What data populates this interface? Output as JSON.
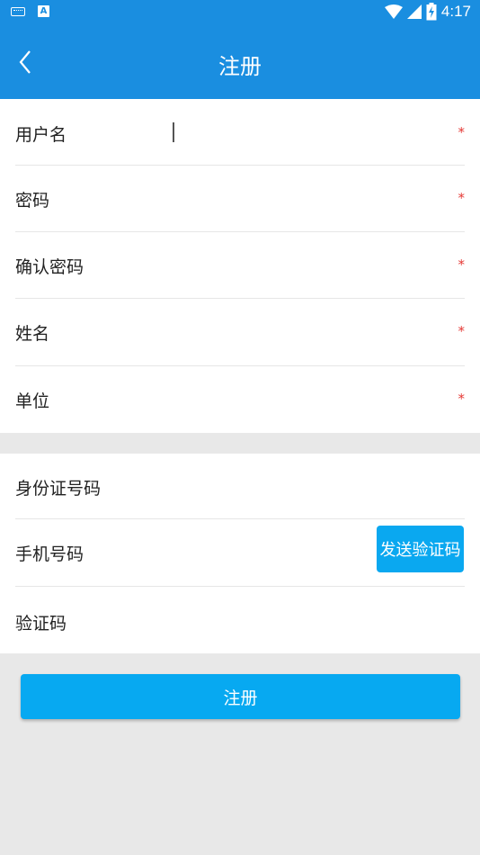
{
  "status_bar": {
    "time": "4:17",
    "icons": [
      "keyboard-icon",
      "a-notification-icon",
      "wifi-icon",
      "signal-icon",
      "battery-charging-icon"
    ]
  },
  "app_bar": {
    "title": "注册",
    "back_icon": "chevron-left-icon"
  },
  "form": {
    "required_mark": "*",
    "username": {
      "label": "用户名",
      "value": "",
      "required": true
    },
    "password": {
      "label": "密码",
      "value": "",
      "required": true
    },
    "confirm_password": {
      "label": "确认密码",
      "value": "",
      "required": true
    },
    "name": {
      "label": "姓名",
      "value": "",
      "required": true
    },
    "unit": {
      "label": "单位",
      "value": "",
      "required": true
    },
    "id_number": {
      "label": "身份证号码",
      "value": "",
      "required": false
    },
    "phone": {
      "label": "手机号码",
      "value": "",
      "required": false
    },
    "send_code_label": "发送验证码",
    "verification_code": {
      "label": "验证码",
      "value": "",
      "required": false
    }
  },
  "submit_label": "注册",
  "colors": {
    "primary": "#1a8ee0",
    "button": "#07a9f1",
    "required": "#e53935",
    "background": "#e8e8e8"
  }
}
